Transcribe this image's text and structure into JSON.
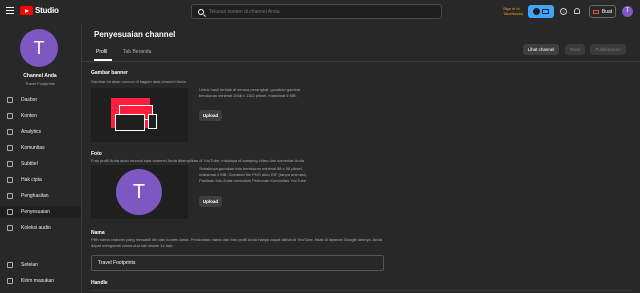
{
  "topbar": {
    "logo_text": "Studio",
    "search_placeholder": "Telusuri konten di channel Anda",
    "signin_link": "Sign in to Tabelbooks",
    "create_label": "Buat",
    "avatar_letter": "T"
  },
  "sidebar": {
    "avatar_letter": "T",
    "channel_name": "Channel Anda",
    "channel_sub": "Travel Footprints",
    "items": [
      {
        "label": "Dasbor",
        "icon": "dashboard-icon"
      },
      {
        "label": "Konten",
        "icon": "content-icon"
      },
      {
        "label": "Analytics",
        "icon": "analytics-icon"
      },
      {
        "label": "Komunitas",
        "icon": "community-icon"
      },
      {
        "label": "Subtitel",
        "icon": "subtitles-icon"
      },
      {
        "label": "Hak cipta",
        "icon": "copyright-icon"
      },
      {
        "label": "Penghasilan",
        "icon": "earn-icon"
      },
      {
        "label": "Penyesuaian",
        "icon": "customization-icon"
      },
      {
        "label": "Koleksi audio",
        "icon": "audio-library-icon"
      }
    ],
    "bottom_items": [
      {
        "label": "Setelan",
        "icon": "settings-icon"
      },
      {
        "label": "Kirim masukan",
        "icon": "feedback-icon"
      }
    ]
  },
  "main": {
    "title": "Penyesuaian channel",
    "tabs": [
      {
        "label": "Profil"
      },
      {
        "label": "Tab Beranda"
      }
    ],
    "buttons": {
      "view_channel": "Lihat channel",
      "cancel": "Batal",
      "publish": "Publikasikan"
    },
    "banner": {
      "title": "Gambar banner",
      "desc": "Gambar ini akan muncul di bagian atas channel Anda",
      "info": "Untuk hasil terbaik di semua perangkat, gunakan gambar berukuran minimal 2048 x 1152 piksel, maksimal 6 MB.",
      "upload": "Upload"
    },
    "photo": {
      "title": "Foto",
      "desc": "Foto profil Anda akan muncul saat channel Anda ditampilkan di YouTube, misalnya di samping video dan komentar Anda",
      "avatar_letter": "T",
      "info": "Sebaiknya gunakan foto berukuran minimal 98 x 98 piksel, maksimal 4 MB. Gunakan file PNG atau GIF (tanpa animasi). Pastikan foto Anda mematuhi Pedoman Komunitas YouTube.",
      "upload": "Upload"
    },
    "name": {
      "title": "Nama",
      "desc": "Pilih nama channel yang mewakili diri dan konten Anda. Perubahan nama dan foto profil Anda hanya dapat dilihat di YouTube, tidak di layanan Google lainnya. Anda dapat mengubah nama dua kali dalam 14 hari.",
      "value": "Travel Footprints"
    },
    "handle": {
      "title": "Handle"
    }
  }
}
